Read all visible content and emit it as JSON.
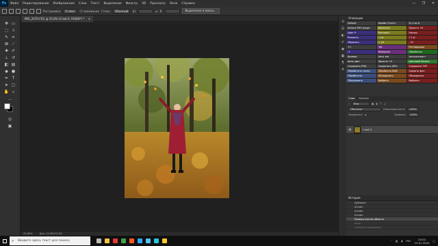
{
  "app": {
    "logo": "Ps"
  },
  "menubar": {
    "items": [
      "Файл",
      "Редактирование",
      "Изображение",
      "Слои",
      "Текст",
      "Выделение",
      "Фильтр",
      "3D",
      "Просмотр",
      "Окно",
      "Справка"
    ],
    "window_controls": [
      "—",
      "❐",
      "✕"
    ]
  },
  "options_bar": {
    "feather_label": "Растушевка:",
    "feather_value": "0 пикс.",
    "smoothing_label": "Сглаживание",
    "style_label": "Стиль:",
    "style_value": "Обычный",
    "select_mask_button": "Выделение и маска..."
  },
  "document": {
    "tab_title": "IMG_2470.CR2 @ 25,8% (Слой 0, RGB/8*) *",
    "tab_close": "×"
  },
  "statusbar": {
    "zoom": "25,89%",
    "doc_info": "Док: 24,9M/33,2M"
  },
  "actions_panel": {
    "title": "Операции",
    "rows": [
      [
        {
          "t": "Default",
          "c": "#3d3d3d"
        },
        {
          "t": "Фрейм 3,5x4,0",
          "c": "#3d3d3d"
        },
        {
          "t": "Уч 4 из 6",
          "c": "#3d3d3d"
        }
      ],
      [
        {
          "t": "Actions FMO plugin",
          "c": "#3d3d3d"
        },
        {
          "t": "Виньетка",
          "c": "#7a7a1e"
        },
        {
          "t": "Яркость +6",
          "c": "#7a1e1e"
        }
      ],
      [
        {
          "t": "Цвет 9",
          "c": "#3a2f7a"
        },
        {
          "t": "Контраст",
          "c": "#7a7a1e"
        },
        {
          "t": "Насыщ",
          "c": "#7a1e1e"
        }
      ],
      [
        {
          "t": "Резкость",
          "c": "#3a2f7a"
        },
        {
          "t": "-1 st",
          "c": "#7a7a1e"
        },
        {
          "t": "+1 st",
          "c": "#7a1e1e"
        }
      ],
      [
        {
          "t": "Сбросить",
          "c": "#3a2f7a"
        },
        {
          "t": "+ 40",
          "c": "#7a7a1e"
        },
        {
          "t": "- 15",
          "c": "#7a1e1e"
        }
      ],
      [
        {
          "t": "+1",
          "c": "#3d3d3d"
        },
        {
          "t": "Ч/Б",
          "c": "#6a2f7a"
        },
        {
          "t": "Реставрация",
          "c": "#7a4a1e"
        }
      ],
      [
        {
          "t": "-1",
          "c": "#3a2f7a"
        },
        {
          "t": "Инверсия",
          "c": "#6a2f7a"
        },
        {
          "t": "Обработка",
          "c": "#1e6a1e"
        }
      ],
      [
        {
          "t": "Кривые",
          "c": "#3d3d3d"
        },
        {
          "t": "Авто тон",
          "c": "#3d3d3d"
        },
        {
          "t": "Автоконтраст",
          "c": "#3d3d3d"
        }
      ],
      [
        {
          "t": "Авто цвет",
          "c": "#3d3d3d"
        },
        {
          "t": "Яркость +5",
          "c": "#3d3d3d"
        },
        {
          "t": "Цветовой баланс",
          "c": "#2f7a2f"
        }
      ],
      [
        {
          "t": "Сохранить PNG",
          "c": "#3d3d3d"
        },
        {
          "t": "Сохранить JPEG",
          "c": "#3d3d3d"
        },
        {
          "t": "Сохранить TIFF",
          "c": "#7a1e1e"
        }
      ],
      [
        {
          "t": "Обработать папку",
          "c": "#3a4f7a"
        },
        {
          "t": "Обработка RAW",
          "c": "#7a4a1e"
        },
        {
          "t": "Удалить фон",
          "c": "#7a1e1e"
        }
      ],
      [
        {
          "t": "Обработать",
          "c": "#3a4f7a"
        },
        {
          "t": "Объединить",
          "c": "#7a4a1e"
        },
        {
          "t": "Объединить",
          "c": "#7a1e1e"
        }
      ],
      [
        {
          "t": "Объединить",
          "c": "#3a4f7a"
        },
        {
          "t": "Выбрать",
          "c": "#7a4a1e"
        },
        {
          "t": "Выбрать",
          "c": "#7a1e1e"
        }
      ]
    ]
  },
  "layers_panel": {
    "tabs": [
      "Слои",
      "Каналы"
    ],
    "kind_label": "Вид",
    "blend_mode": "Обычные",
    "opacity_label": "Непрозрачность:",
    "opacity_value": "100%",
    "lock_label": "Закрепить:",
    "fill_label": "Заливка:",
    "fill_value": "100%",
    "layer_name": "Слой 0"
  },
  "history_panel": {
    "title": "История",
    "items": [
      {
        "t": "Дубликат",
        "state": "normal"
      },
      {
        "t": "Штамп",
        "state": "normal"
      },
      {
        "t": "Штамп",
        "state": "normal"
      },
      {
        "t": "Штамп",
        "state": "normal"
      },
      {
        "t": "Прямоугольная область",
        "state": "current"
      },
      {
        "t": "Кадр",
        "state": "dim"
      },
      {
        "t": "Отменить выделение",
        "state": "dim"
      }
    ]
  },
  "taskbar": {
    "search_placeholder": "Введите здесь текст для поиска",
    "tray_lang": "РУС",
    "time": "20:02",
    "date": "15.01.2020",
    "apps": [
      {
        "icon": "task-view-icon",
        "color": "#bbbbbb"
      },
      {
        "icon": "file-explorer-icon",
        "color": "#f5c542"
      },
      {
        "icon": "opera-icon",
        "color": "#e53935"
      },
      {
        "icon": "chrome-icon",
        "color": "#43a047"
      },
      {
        "icon": "yandex-icon",
        "color": "#ff5722"
      },
      {
        "icon": "photoshop-icon",
        "color": "#31a8ff"
      },
      {
        "icon": "lightroom-icon",
        "color": "#4fc3f7"
      },
      {
        "icon": "app-icon",
        "color": "#26c6da"
      },
      {
        "icon": "app-icon-2",
        "color": "#ffca28"
      }
    ]
  }
}
